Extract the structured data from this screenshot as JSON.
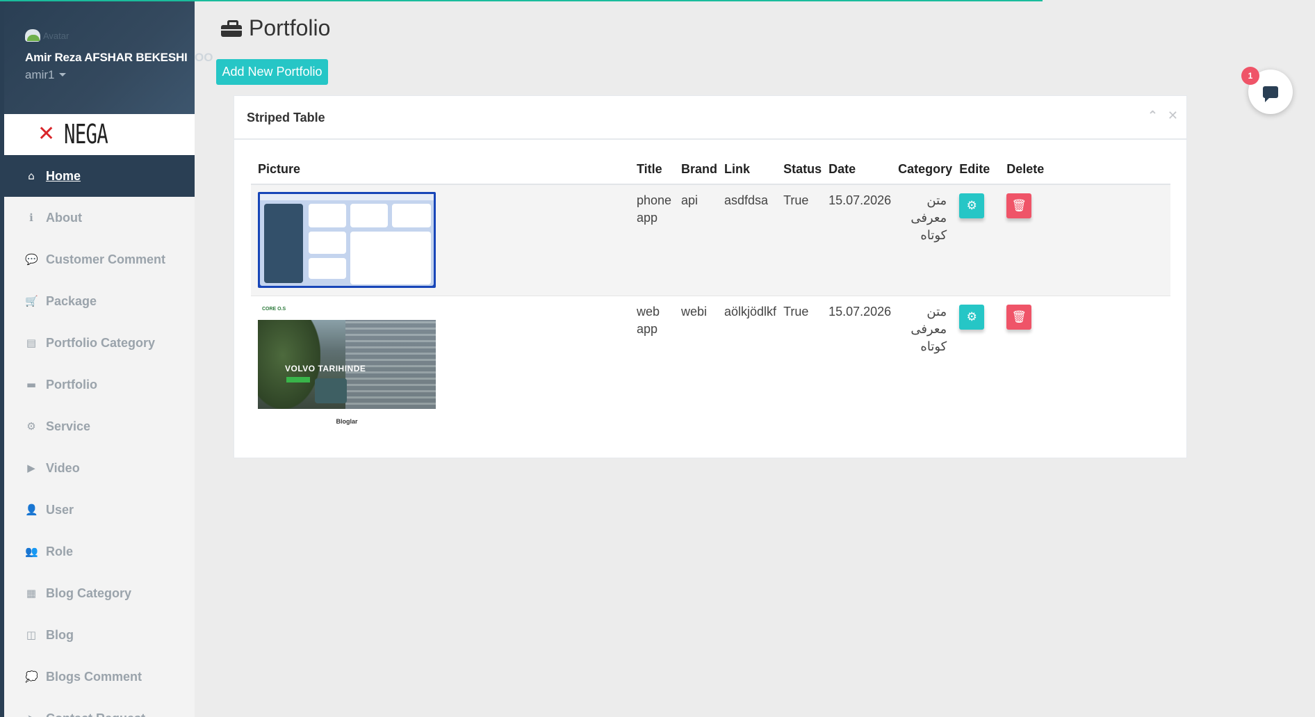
{
  "sidebar": {
    "avatar_alt": "Avatar",
    "user_name": "Amir Reza AFSHAR BEKESHI",
    "user_name_overflow": "OO",
    "username": "amir1",
    "logo_text": "NEGA",
    "items": [
      {
        "label": "Home",
        "icon": "home-icon",
        "glyph": "⌂"
      },
      {
        "label": "About",
        "icon": "info-icon",
        "glyph": "ℹ"
      },
      {
        "label": "Customer Comment",
        "icon": "comment-icon",
        "glyph": "💬"
      },
      {
        "label": "Package",
        "icon": "cart-icon",
        "glyph": "🛒"
      },
      {
        "label": "Portfolio Category",
        "icon": "archive-icon",
        "glyph": "▤"
      },
      {
        "label": "Portfolio",
        "icon": "briefcase-icon",
        "glyph": "▬"
      },
      {
        "label": "Service",
        "icon": "gears-icon",
        "glyph": "⚙"
      },
      {
        "label": "Video",
        "icon": "youtube-icon",
        "glyph": "▶"
      },
      {
        "label": "User",
        "icon": "user-icon",
        "glyph": "👤"
      },
      {
        "label": "Role",
        "icon": "users-icon",
        "glyph": "👥"
      },
      {
        "label": "Blog Category",
        "icon": "sitemap-icon",
        "glyph": "▦"
      },
      {
        "label": "Blog",
        "icon": "columns-icon",
        "glyph": "◫"
      },
      {
        "label": "Blogs Comment",
        "icon": "comments-icon",
        "glyph": "💭"
      },
      {
        "label": "Contact Request",
        "icon": "send-icon",
        "glyph": "➤"
      }
    ]
  },
  "page": {
    "title": "Portfolio",
    "add_button": "Add New Portfolio"
  },
  "panel": {
    "title": "Striped Table",
    "collapse_glyph": "⌃",
    "close_glyph": "✕"
  },
  "table": {
    "headers": [
      "Picture",
      "Title",
      "Brand",
      "Link",
      "Status",
      "Date",
      "Category",
      "Edite",
      "Delete"
    ],
    "rows": [
      {
        "picture": "app dashboard screenshot",
        "title": "phone app",
        "brand": "api",
        "link": "asdfdsa",
        "status": "True",
        "date": "15.07.2026",
        "category": "متن معرفی کوتاه"
      },
      {
        "picture": "website hero screenshot",
        "title": "web app",
        "brand": "webi",
        "link": "aölkjödlkf",
        "status": "True",
        "date": "15.07.2026",
        "category": "متن معرفی کوتاه"
      }
    ],
    "thumb2": {
      "brand": "CORE O.S",
      "hero_text": "VOLVO TARIHINDE",
      "footer_text": "Bloglar"
    },
    "edit_glyph": "⚙",
    "delete_glyph": "🗑"
  },
  "chat": {
    "badge_count": "1",
    "icon": "chat-icon"
  },
  "colors": {
    "sidebar_dark": "#2a3f54",
    "accent_teal": "#26c6c6",
    "danger": "#ef5468",
    "progress": "#1abc9c"
  }
}
